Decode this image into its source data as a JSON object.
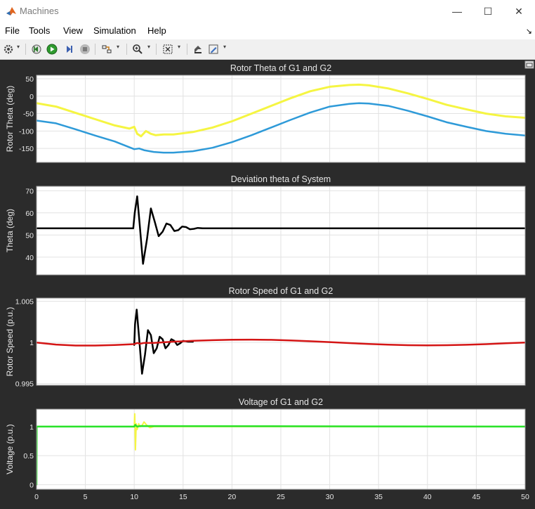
{
  "window": {
    "title": "Machines",
    "minimize_glyph": "—",
    "maximize_glyph": "☐",
    "close_glyph": "✕",
    "icon": "matlab-icon"
  },
  "menu": {
    "items": [
      "File",
      "Tools",
      "View",
      "Simulation",
      "Help"
    ],
    "dock_glyph": "↘"
  },
  "toolbar": {
    "icons": [
      "gear-icon",
      "rewind-icon",
      "run-icon",
      "step-forward-icon",
      "stop-icon",
      "signal-icon",
      "zoom-icon",
      "fit-icon",
      "style-icon",
      "edit-icon"
    ],
    "dropdown_glyph": "▾"
  },
  "colors": {
    "plot_bg": "#ffffff",
    "scope_bg": "#2b2b2b",
    "yellow": "#f5f542",
    "blue": "#2e9ad8",
    "black": "#000000",
    "red": "#d41515",
    "green": "#27e227",
    "grid": "#e2e2e2",
    "text": "#e6e6e6"
  },
  "chart_data": [
    {
      "type": "line",
      "title": "Rotor Theta of G1 and G2",
      "ylabel": "Rotor Theta (deg)",
      "xlim": [
        0,
        50
      ],
      "ylim": [
        -190,
        60
      ],
      "yticks": [
        -150,
        -100,
        -50,
        0,
        50
      ],
      "ytick_labels": [
        "-150",
        "-100",
        "-50",
        "0",
        "50"
      ],
      "xticks": [
        0,
        5,
        10,
        15,
        20,
        25,
        30,
        35,
        40,
        45,
        50
      ],
      "xtick_labels": [],
      "grid": true,
      "series": [
        {
          "color": "#f5f542",
          "width": 3,
          "x": [
            0,
            2,
            4,
            6,
            8,
            9.5,
            10,
            10.3,
            10.7,
            11.2,
            11.7,
            12.2,
            13,
            14,
            16,
            18,
            20,
            22,
            24,
            26,
            28,
            30,
            32,
            33,
            34,
            36,
            38,
            40,
            42,
            44,
            46,
            48,
            50
          ],
          "y": [
            -20,
            -30,
            -48,
            -66,
            -84,
            -93,
            -88,
            -108,
            -115,
            -100,
            -108,
            -112,
            -110,
            -110,
            -103,
            -90,
            -72,
            -50,
            -28,
            -6,
            14,
            27,
            32,
            33,
            31,
            22,
            8,
            -8,
            -25,
            -38,
            -50,
            -58,
            -62
          ]
        },
        {
          "color": "#2e9ad8",
          "width": 2.5,
          "x": [
            0,
            2,
            4,
            6,
            8,
            10,
            10.5,
            11,
            12,
            13,
            14,
            16,
            18,
            20,
            22,
            24,
            26,
            28,
            30,
            32,
            33,
            34,
            36,
            38,
            40,
            42,
            44,
            46,
            48,
            50
          ],
          "y": [
            -70,
            -78,
            -95,
            -113,
            -130,
            -152,
            -150,
            -155,
            -160,
            -162,
            -162,
            -158,
            -148,
            -132,
            -112,
            -90,
            -68,
            -47,
            -30,
            -22,
            -20,
            -21,
            -28,
            -42,
            -58,
            -75,
            -88,
            -100,
            -108,
            -113
          ]
        }
      ]
    },
    {
      "type": "line",
      "title": "Deviation theta of System",
      "ylabel": "Theta (deg)",
      "xlim": [
        0,
        50
      ],
      "ylim": [
        32,
        72
      ],
      "yticks": [
        40,
        50,
        60,
        70
      ],
      "ytick_labels": [
        "40",
        "50",
        "60",
        "70"
      ],
      "xticks": [
        0,
        5,
        10,
        15,
        20,
        25,
        30,
        35,
        40,
        45,
        50
      ],
      "xtick_labels": [],
      "grid": true,
      "series": [
        {
          "color": "#000000",
          "width": 2.5,
          "x": [
            0,
            9.9,
            10.05,
            10.3,
            10.55,
            10.9,
            11.3,
            11.7,
            12.1,
            12.5,
            12.9,
            13.3,
            13.7,
            14.1,
            14.5,
            14.9,
            15.3,
            15.7,
            16.1,
            16.5,
            17,
            50
          ],
          "y": [
            53,
            53,
            60,
            67.5,
            55,
            37,
            48,
            62,
            56,
            49.5,
            51.5,
            55.2,
            54.5,
            51.8,
            52.2,
            53.8,
            53.6,
            52.6,
            52.8,
            53.2,
            53,
            53
          ]
        }
      ]
    },
    {
      "type": "line",
      "title": "Rotor Speed of G1 and G2",
      "ylabel": "Rotor Speed (p.u.)",
      "xlim": [
        0,
        50
      ],
      "ylim": [
        0.9948,
        1.0054
      ],
      "yticks": [
        0.995,
        1,
        1.005
      ],
      "ytick_labels": [
        "0.995",
        "1",
        "1.005"
      ],
      "xticks": [
        0,
        5,
        10,
        15,
        20,
        25,
        30,
        35,
        40,
        45,
        50
      ],
      "xtick_labels": [],
      "grid": true,
      "series": [
        {
          "color": "#000000",
          "width": 2.5,
          "x": [
            10,
            10.08,
            10.25,
            10.5,
            10.8,
            11.1,
            11.4,
            11.7,
            12,
            12.3,
            12.6,
            12.9,
            13.2,
            13.5,
            13.8,
            14.1,
            14.4,
            14.7,
            15,
            15.5,
            16
          ],
          "y": [
            0.9997,
            1.0022,
            1.004,
            1.0005,
            0.9962,
            0.9985,
            1.0015,
            1.0009,
            0.9987,
            0.9993,
            1.0007,
            1.0004,
            0.9993,
            0.9997,
            1.0004,
            1.0002,
            0.9997,
            0.9999,
            1.0002,
            1.0001,
            1.0001
          ]
        },
        {
          "color": "#d41515",
          "width": 2.5,
          "x": [
            0,
            2,
            4,
            6,
            8,
            10,
            10.3,
            10.6,
            11,
            12,
            14,
            16,
            18,
            20,
            22,
            24,
            26,
            28,
            30,
            32,
            34,
            36,
            38,
            40,
            42,
            44,
            46,
            48,
            50
          ],
          "y": [
            1.0,
            0.99975,
            0.99963,
            0.99963,
            0.9997,
            0.9998,
            0.99995,
            0.99985,
            0.99995,
            0.99995,
            1.0001,
            1.0002,
            1.00028,
            1.00033,
            1.00035,
            1.00032,
            1.00025,
            1.00015,
            1.00005,
            0.99993,
            0.99982,
            0.99973,
            0.99967,
            0.99965,
            0.99967,
            0.99972,
            0.9998,
            0.9999,
            1.0
          ]
        }
      ]
    },
    {
      "type": "line",
      "title": "Voltage of G1 and G2",
      "ylabel": "Voltage (p.u.)",
      "xlim": [
        0,
        50
      ],
      "ylim": [
        -0.08,
        1.3
      ],
      "yticks": [
        0,
        0.5,
        1
      ],
      "ytick_labels": [
        "0",
        "0.5",
        "1"
      ],
      "xticks": [
        0,
        5,
        10,
        15,
        20,
        25,
        30,
        35,
        40,
        45,
        50
      ],
      "xtick_labels": [
        "0",
        "5",
        "10",
        "15",
        "20",
        "25",
        "30",
        "35",
        "40",
        "45",
        "50"
      ],
      "grid": true,
      "series": [
        {
          "color": "#f5f542",
          "width": 2,
          "x": [
            10,
            10.05,
            10.12,
            10.2,
            10.3,
            10.45,
            10.6,
            10.8,
            11,
            11.3,
            11.6,
            12,
            50
          ],
          "y": [
            1.0,
            1.22,
            0.6,
            1.05,
            0.95,
            1.05,
            1.0,
            1.02,
            1.08,
            1.02,
            0.98,
            1.0,
            1.0
          ]
        },
        {
          "color": "#27e227",
          "width": 2.5,
          "x": [
            0,
            0.02,
            10,
            10.1,
            10.3,
            10.6,
            50
          ],
          "y": [
            0.0,
            1.0,
            1.0,
            1.03,
            1.0,
            1.01,
            1.0
          ]
        }
      ]
    }
  ]
}
